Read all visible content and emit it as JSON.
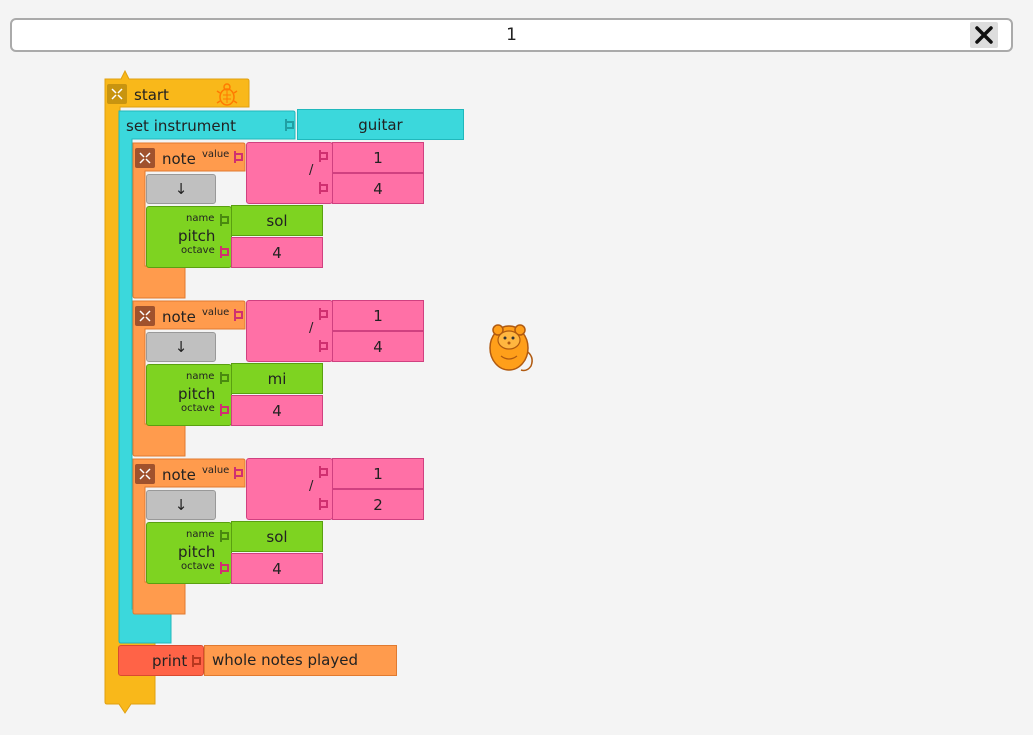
{
  "search": {
    "value": "1"
  },
  "start_block": {
    "label": "start"
  },
  "set_instrument": {
    "label": "set instrument",
    "value": "guitar"
  },
  "notes": [
    {
      "label": "note",
      "value_label": "value",
      "divide_symbol": "/",
      "numerator": "1",
      "denominator": "4",
      "arrow": "↓",
      "pitch_label": "pitch",
      "name_label": "name",
      "octave_label": "octave",
      "pitch_name": "sol",
      "octave": "4"
    },
    {
      "label": "note",
      "value_label": "value",
      "divide_symbol": "/",
      "numerator": "1",
      "denominator": "4",
      "arrow": "↓",
      "pitch_label": "pitch",
      "name_label": "name",
      "octave_label": "octave",
      "pitch_name": "mi",
      "octave": "4"
    },
    {
      "label": "note",
      "value_label": "value",
      "divide_symbol": "/",
      "numerator": "1",
      "denominator": "2",
      "arrow": "↓",
      "pitch_label": "pitch",
      "name_label": "name",
      "octave_label": "octave",
      "pitch_name": "sol",
      "octave": "4"
    }
  ],
  "print_block": {
    "label": "print",
    "value": "whole notes played"
  },
  "colors": {
    "start": "#f9b81a",
    "instrument": "#3bd8dc",
    "note": "#ff9b4d",
    "divide": "#ff70a6",
    "pitch": "#7ed321",
    "print": "#ff6347",
    "print_value": "#ff9b4d",
    "arrow": "#c0c0c0"
  },
  "icons": {
    "close": "close-icon",
    "turtle": "mouse-turtle-icon",
    "collapse": "collapse-icon",
    "start_turtle": "turtle-icon"
  }
}
